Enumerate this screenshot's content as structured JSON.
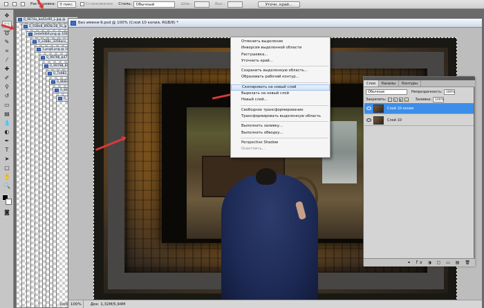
{
  "options_bar": {
    "feather_label": "Растушевка:",
    "feather_value": "0 пикс.",
    "smoothing_label": "Сглаживание",
    "style_label": "Стиль:",
    "style_value": "Обычный",
    "width_label": "Шир.:",
    "height_label": "Выс.:",
    "refine_edge_button": "Уточн. край..."
  },
  "documents": [
    {
      "tab": "0_9674a_ba42e90_L.jpg @"
    },
    {
      "tab": "0_938e8_8928c28_XL.jp"
    },
    {
      "tab": "2ede9db9.png @ 100%"
    },
    {
      "tab": "0_e388c_3356acs_X"
    },
    {
      "tab": "1.png4.png @ 100"
    },
    {
      "tab": "0_99796_b4713"
    },
    {
      "tab": "0_99798_696"
    },
    {
      "tab": "0_7a982_b"
    },
    {
      "tab": "0_8b8c_"
    },
    {
      "tab": "0_8434"
    },
    {
      "tab": "0_7"
    }
  ],
  "doc_zoom": "100%",
  "main_window": {
    "title": "Без имени-9.psd @ 100% (Слой 10 копия, RGB/8) *",
    "status_zoom": "100%",
    "status_doc": "Док: 1,32M/5,94M"
  },
  "context_menu": {
    "items": [
      {
        "label": "Отменить выделение"
      },
      {
        "label": "Инверсия выделенной области"
      },
      {
        "label": "Растушевка..."
      },
      {
        "label": "Уточнить край..."
      },
      {
        "label": "Сохранить выделенную область..."
      },
      {
        "label": "Образовать рабочий контур..."
      },
      {
        "label": "Скопировать на новый слой"
      },
      {
        "label": "Вырезать на новый слой"
      },
      {
        "label": "Новый слой..."
      },
      {
        "label": "Свободное трансформирование"
      },
      {
        "label": "Трансформировать выделенную область"
      },
      {
        "label": "Выполнить заливку..."
      },
      {
        "label": "Выполнить обводку..."
      },
      {
        "label": "Perspective Shadow"
      },
      {
        "label": "Осветлить..."
      }
    ]
  },
  "layers_panel": {
    "tabs": [
      "Слои",
      "Каналы",
      "Контуры"
    ],
    "blend_mode": "Обычные",
    "opacity_label": "Непрозрачность:",
    "opacity_value": "100%",
    "lock_label": "Закрепить:",
    "fill_label": "Заливка:",
    "fill_value": "100%",
    "layers": [
      {
        "name": "Слой 10 копия"
      },
      {
        "name": "Слой 10"
      }
    ],
    "bottom_icons": "⚭ fx ◑ ▢ ▭ ▤ 🗑"
  },
  "colors": {
    "accent": "#3d8ee8",
    "arrow": "#d83a3a",
    "menu_bg": "#f5f5f5"
  }
}
